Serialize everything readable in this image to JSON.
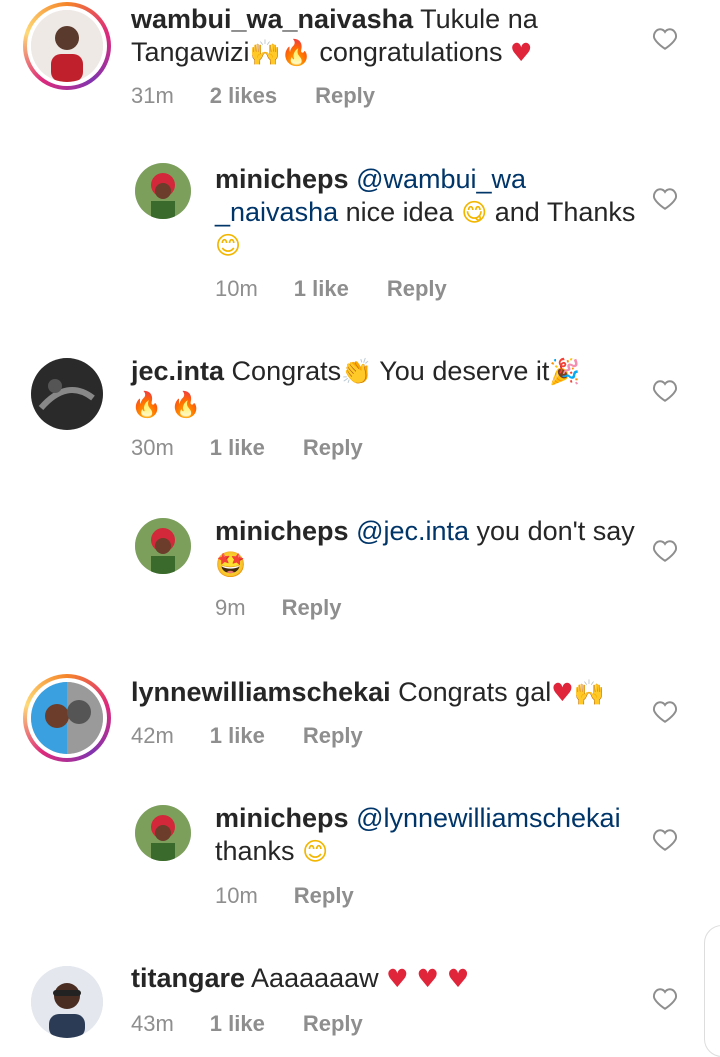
{
  "comments": [
    {
      "user": "wambui_wa_naivasha",
      "text_a": "Tukule na Tangawizi",
      "emoji_1": "🙌",
      "emoji_2": "🔥",
      "text_b": " congratulations ",
      "emoji_3": "♥",
      "time": "31m",
      "likes": "2 likes",
      "reply": "Reply",
      "avatar": "avatar-woman-red"
    },
    {
      "user": "minicheps",
      "mention": "@wambui_wa _naivasha",
      "text_a": " nice idea ",
      "emoji_1": "😋",
      "text_b": " and Thanks ",
      "emoji_2": "😊",
      "time": "10m",
      "likes": "1 like",
      "reply": "Reply",
      "avatar": "avatar-red-hair"
    },
    {
      "user": "jec.inta",
      "text_a": " Congrats",
      "emoji_1": "👏",
      "text_b": "  You deserve it",
      "emoji_2": "🎉",
      "emoji_3": "🔥 🔥",
      "time": "30m",
      "likes": "1 like",
      "reply": "Reply",
      "avatar": "avatar-dark"
    },
    {
      "user": "minicheps",
      "mention": "@jec.inta",
      "text_a": " you don't say ",
      "emoji_1": "🤩",
      "time": "9m",
      "reply": "Reply",
      "avatar": "avatar-red-hair"
    },
    {
      "user": "lynnewilliamschekai",
      "text_a": " Congrats gal",
      "emoji_1": "♥",
      "emoji_2": "🙌",
      "time": "42m",
      "likes": "1 like",
      "reply": "Reply",
      "avatar": "avatar-couple"
    },
    {
      "user": "minicheps",
      "mention": "@lynnewilliamschekai",
      "text_a": " thanks ",
      "emoji_1": "😊",
      "time": "10m",
      "reply": "Reply",
      "avatar": "avatar-red-hair"
    },
    {
      "user": "titangare",
      "text_a": " Aaaaaaaw ",
      "emoji_1": "♥ ♥ ♥",
      "time": "43m",
      "likes": "1 like",
      "reply": "Reply",
      "avatar": "avatar-woman-glasses"
    }
  ],
  "colors": {
    "accent": "#003569",
    "muted": "#8e8e8e",
    "heart_red": "#e0243a"
  }
}
